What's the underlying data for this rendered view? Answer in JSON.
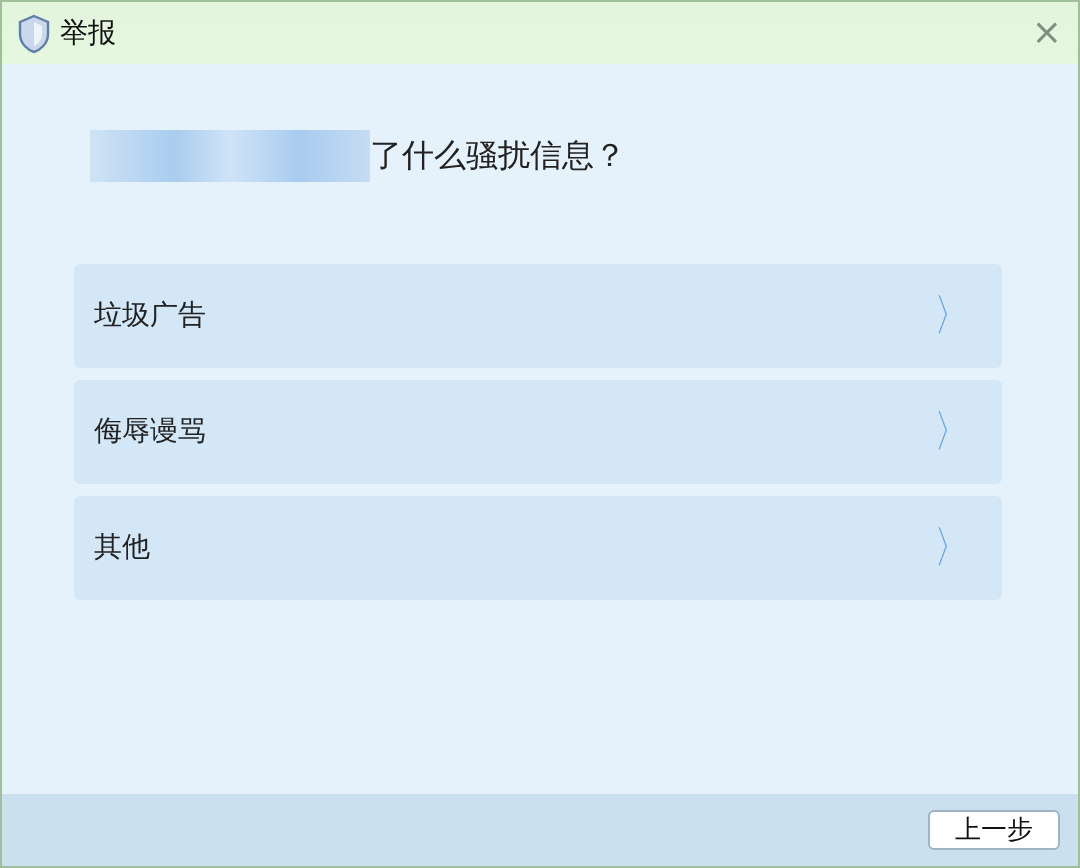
{
  "window": {
    "title": "举报",
    "close": "×"
  },
  "question": "了什么骚扰信息？",
  "options": [
    {
      "label": "垃圾广告",
      "arrow": "〉"
    },
    {
      "label": "侮辱谩骂",
      "arrow": "〉"
    },
    {
      "label": "其他",
      "arrow": "〉"
    }
  ],
  "buttons": [
    "上一步"
  ]
}
